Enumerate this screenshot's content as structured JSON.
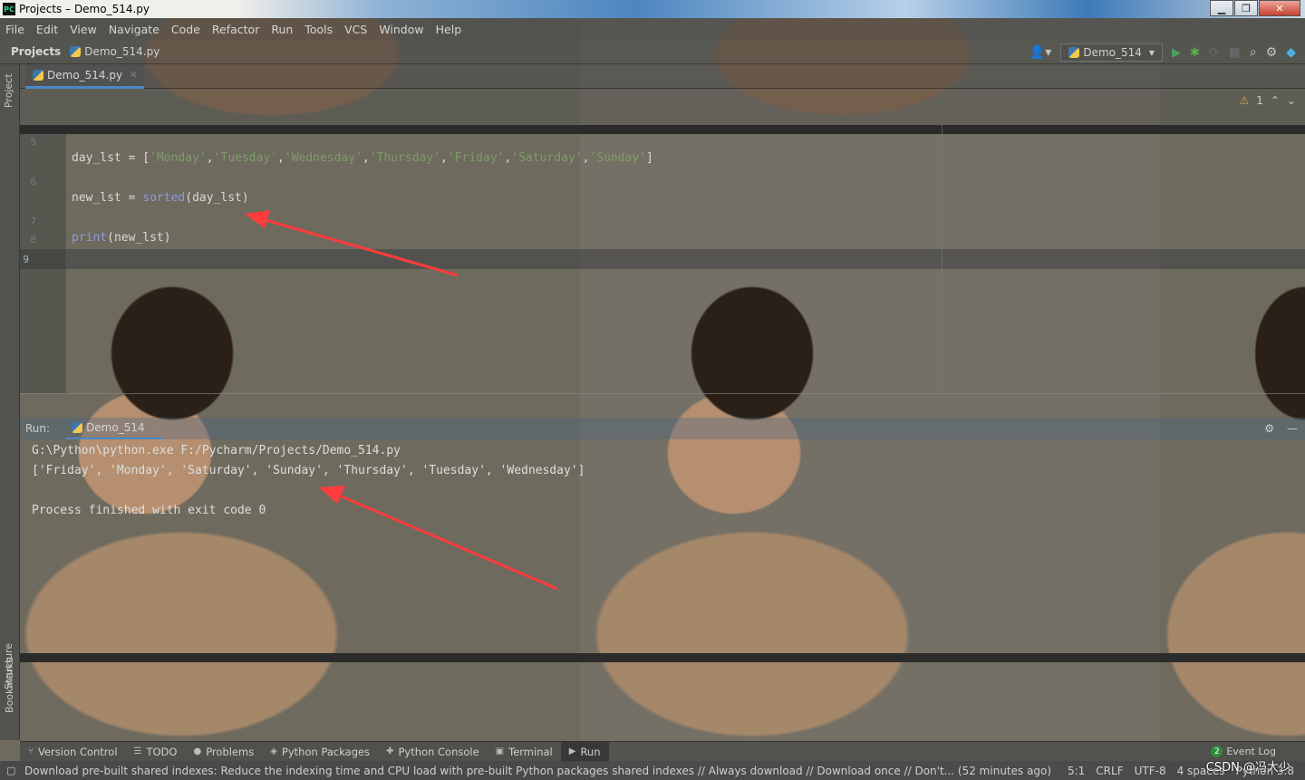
{
  "window": {
    "title": "Projects – Demo_514.py",
    "app_icon": "PC"
  },
  "menu": [
    "File",
    "Edit",
    "View",
    "Navigate",
    "Code",
    "Refactor",
    "Run",
    "Tools",
    "VCS",
    "Window",
    "Help"
  ],
  "navbar": {
    "project_label": "Projects",
    "file": "Demo_514.py",
    "run_config": "Demo_514"
  },
  "left_stripe": {
    "project": "Project",
    "structure": "Structure",
    "bookmarks": "Bookmarks"
  },
  "editor": {
    "tab": "Demo_514.py",
    "warnings": "1",
    "line_numbers": [
      "5",
      "6",
      "7",
      "8",
      "9"
    ],
    "active_line": "9",
    "code": {
      "line1_prefix": "day_lst = [",
      "days": [
        "'Monday'",
        "'Tuesday'",
        "'Wednesday'",
        "'Thursday'",
        "'Friday'",
        "'Saturday'",
        "'Sunday'"
      ],
      "comma": ",",
      "line1_suffix": "]",
      "line2_var": "new_lst = ",
      "line2_fn": "sorted",
      "line2_args": "(day_lst)",
      "line3_fn": "print",
      "line3_args": "(new_lst)"
    }
  },
  "run_panel": {
    "label": "Run:",
    "tab": "Demo_514",
    "output": [
      "G:\\Python\\python.exe F:/Pycharm/Projects/Demo_514.py",
      "['Friday', 'Monday', 'Saturday', 'Sunday', 'Thursday', 'Tuesday', 'Wednesday']",
      "",
      "Process finished with exit code 0"
    ]
  },
  "tool_windows": [
    "Version Control",
    "TODO",
    "Problems",
    "Python Packages",
    "Python Console",
    "Terminal",
    "Run"
  ],
  "event_log": {
    "label": "Event Log",
    "count": "2"
  },
  "status": {
    "message": "Download pre-built shared indexes: Reduce the indexing time and CPU load with pre-built Python packages shared indexes // Always download // Download once // Don't... (52 minutes ago)",
    "position": "5:1",
    "line_sep": "CRLF",
    "encoding": "UTF-8",
    "indent": "4 spaces",
    "interpreter": "Python 3.8"
  },
  "watermark": "CSDN @冯大少",
  "colors": {
    "accent": "#4a88c7",
    "arrow": "#ff3b3b",
    "string": "#6a8759",
    "builtin": "#8888c6"
  }
}
